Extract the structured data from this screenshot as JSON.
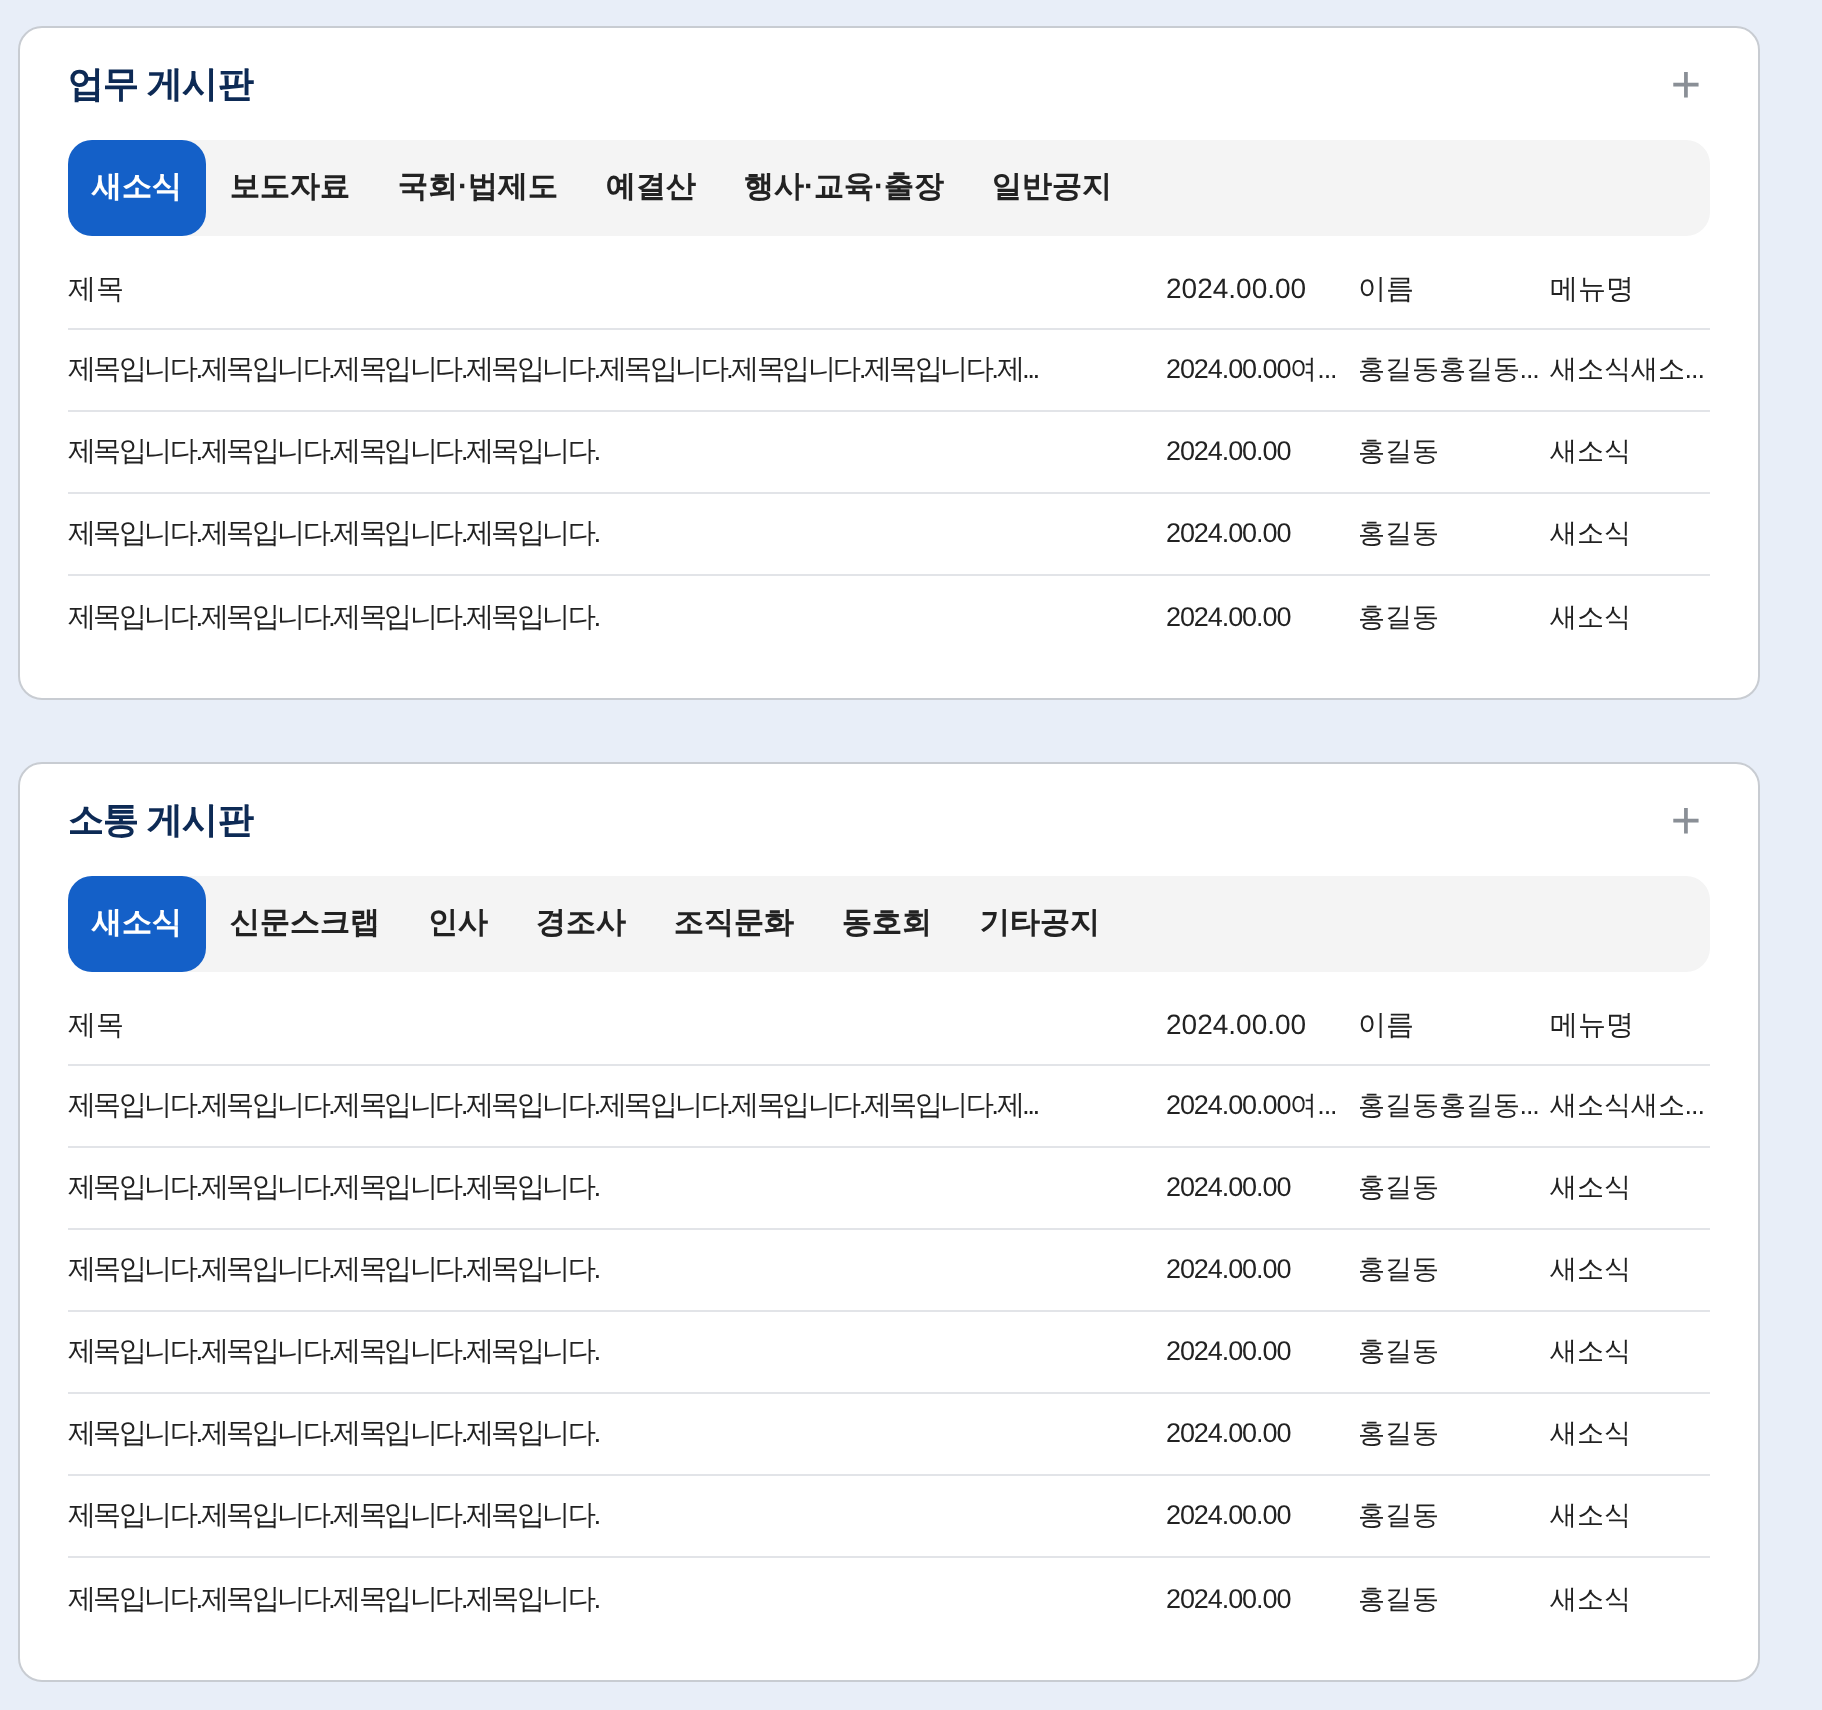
{
  "boards": [
    {
      "title": "업무 게시판",
      "add_button": "+",
      "tabs": [
        {
          "label": "새소식",
          "selected": true
        },
        {
          "label": "보도자료",
          "selected": false
        },
        {
          "label": "국회·법제도",
          "selected": false
        },
        {
          "label": "예결산",
          "selected": false
        },
        {
          "label": "행사·교육·출장",
          "selected": false
        },
        {
          "label": "일반공지",
          "selected": false
        }
      ],
      "columns": [
        "제목",
        "2024.00.00",
        "이름",
        "메뉴명"
      ],
      "rows": [
        [
          "제목입니다.제목입니다.제목입니다.제목입니다.제목입니다.제목입니다.제목입니다.제...",
          "2024.00.00여...",
          "홍길동홍길동...",
          "새소식새소..."
        ],
        [
          "제목입니다.제목입니다.제목입니다.제목입니다.",
          "2024.00.00",
          "홍길동",
          "새소식"
        ],
        [
          "제목입니다.제목입니다.제목입니다.제목입니다.",
          "2024.00.00",
          "홍길동",
          "새소식"
        ],
        [
          "제목입니다.제목입니다.제목입니다.제목입니다.",
          "2024.00.00",
          "홍길동",
          "새소식"
        ]
      ]
    },
    {
      "title": "소통 게시판",
      "add_button": "+",
      "tabs": [
        {
          "label": "새소식",
          "selected": true
        },
        {
          "label": "신문스크랩",
          "selected": false
        },
        {
          "label": "인사",
          "selected": false
        },
        {
          "label": "경조사",
          "selected": false
        },
        {
          "label": "조직문화",
          "selected": false
        },
        {
          "label": "동호회",
          "selected": false
        },
        {
          "label": "기타공지",
          "selected": false
        }
      ],
      "columns": [
        "제목",
        "2024.00.00",
        "이름",
        "메뉴명"
      ],
      "rows": [
        [
          "제목입니다.제목입니다.제목입니다.제목입니다.제목입니다.제목입니다.제목입니다.제...",
          "2024.00.00여...",
          "홍길동홍길동...",
          "새소식새소..."
        ],
        [
          "제목입니다.제목입니다.제목입니다.제목입니다.",
          "2024.00.00",
          "홍길동",
          "새소식"
        ],
        [
          "제목입니다.제목입니다.제목입니다.제목입니다.",
          "2024.00.00",
          "홍길동",
          "새소식"
        ],
        [
          "제목입니다.제목입니다.제목입니다.제목입니다.",
          "2024.00.00",
          "홍길동",
          "새소식"
        ],
        [
          "제목입니다.제목입니다.제목입니다.제목입니다.",
          "2024.00.00",
          "홍길동",
          "새소식"
        ],
        [
          "제목입니다.제목입니다.제목입니다.제목입니다.",
          "2024.00.00",
          "홍길동",
          "새소식"
        ],
        [
          "제목입니다.제목입니다.제목입니다.제목입니다.",
          "2024.00.00",
          "홍길동",
          "새소식"
        ]
      ]
    }
  ]
}
